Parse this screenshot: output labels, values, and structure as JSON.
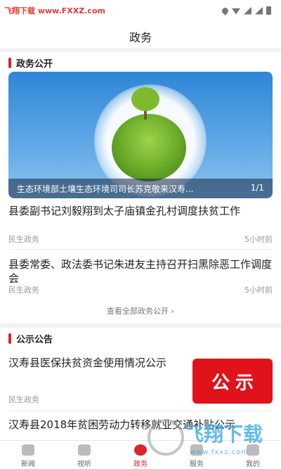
{
  "status_bar": {
    "watermark": "飞翔下载 www.FXXZ.com",
    "icons": [
      "location-icon",
      "wifi-icon",
      "signal-icon",
      "battery-icon"
    ]
  },
  "header": {
    "title": "政务"
  },
  "gov_section": {
    "title": "政务公开",
    "banner": {
      "caption": "生态环境部土壤生态环境司司长苏克敬来汉寿...",
      "counter": "1/1"
    },
    "news": [
      {
        "title": "县委副书记刘毅翔到太子庙镇金孔村调度扶贫工作",
        "category": "民生政务",
        "time": "5小时前"
      },
      {
        "title": "县委常委、政法委书记朱进友主持召开扫黑除恶工作调度会",
        "category": "民生政务",
        "time": "5小时前"
      }
    ],
    "view_all": "查看全部政务公开 ›"
  },
  "notice_section": {
    "title": "公示公告",
    "badge": "公示",
    "items": [
      {
        "title": "汉寿县医保扶贫资金使用情况公示",
        "category": "民生政务"
      },
      {
        "title": "汉寿县2018年贫困劳动力转移就业交通补贴公示"
      }
    ]
  },
  "tabbar": {
    "tabs": [
      {
        "label": "新闻",
        "icon": "news-icon"
      },
      {
        "label": "视听",
        "icon": "video-icon"
      },
      {
        "label": "政务",
        "icon": "gov-icon",
        "active": true
      },
      {
        "label": "服务",
        "icon": "service-icon"
      },
      {
        "label": "我的",
        "icon": "profile-icon"
      }
    ]
  },
  "logo_watermark": {
    "text": "飞翔下载",
    "url": "www.fxxz.com"
  },
  "colors": {
    "accent": "#d9232b",
    "badge": "#e0121a"
  }
}
